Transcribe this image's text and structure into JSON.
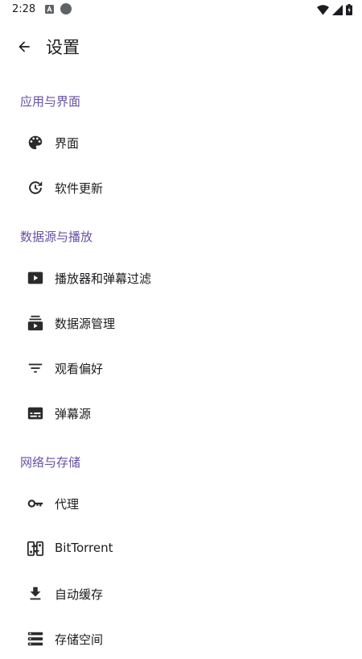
{
  "status_bar": {
    "time": "2:28",
    "icons": [
      "notification-a-icon",
      "notification-circle-icon",
      "wifi-icon",
      "signal-icon",
      "battery-icon"
    ]
  },
  "app_bar": {
    "title": "设置",
    "back_icon": "arrow-back-icon"
  },
  "sections": [
    {
      "header": "应用与界面",
      "items": [
        {
          "label": "界面",
          "icon": "palette-icon"
        },
        {
          "label": "软件更新",
          "icon": "update-icon"
        }
      ]
    },
    {
      "header": "数据源与播放",
      "items": [
        {
          "label": "播放器和弹幕过滤",
          "icon": "play-box-icon"
        },
        {
          "label": "数据源管理",
          "icon": "subscriptions-icon"
        },
        {
          "label": "观看偏好",
          "icon": "filter-list-icon"
        },
        {
          "label": "弹幕源",
          "icon": "subtitles-icon"
        }
      ]
    },
    {
      "header": "网络与存储",
      "items": [
        {
          "label": "代理",
          "icon": "key-icon"
        },
        {
          "label": "BitTorrent",
          "icon": "bittorrent-icon"
        },
        {
          "label": "自动缓存",
          "icon": "download-icon"
        },
        {
          "label": "存储空间",
          "icon": "storage-icon"
        }
      ]
    }
  ],
  "colors": {
    "accent": "#6750a4",
    "text": "#1c1b1f",
    "icon": "#2b2b2b"
  }
}
